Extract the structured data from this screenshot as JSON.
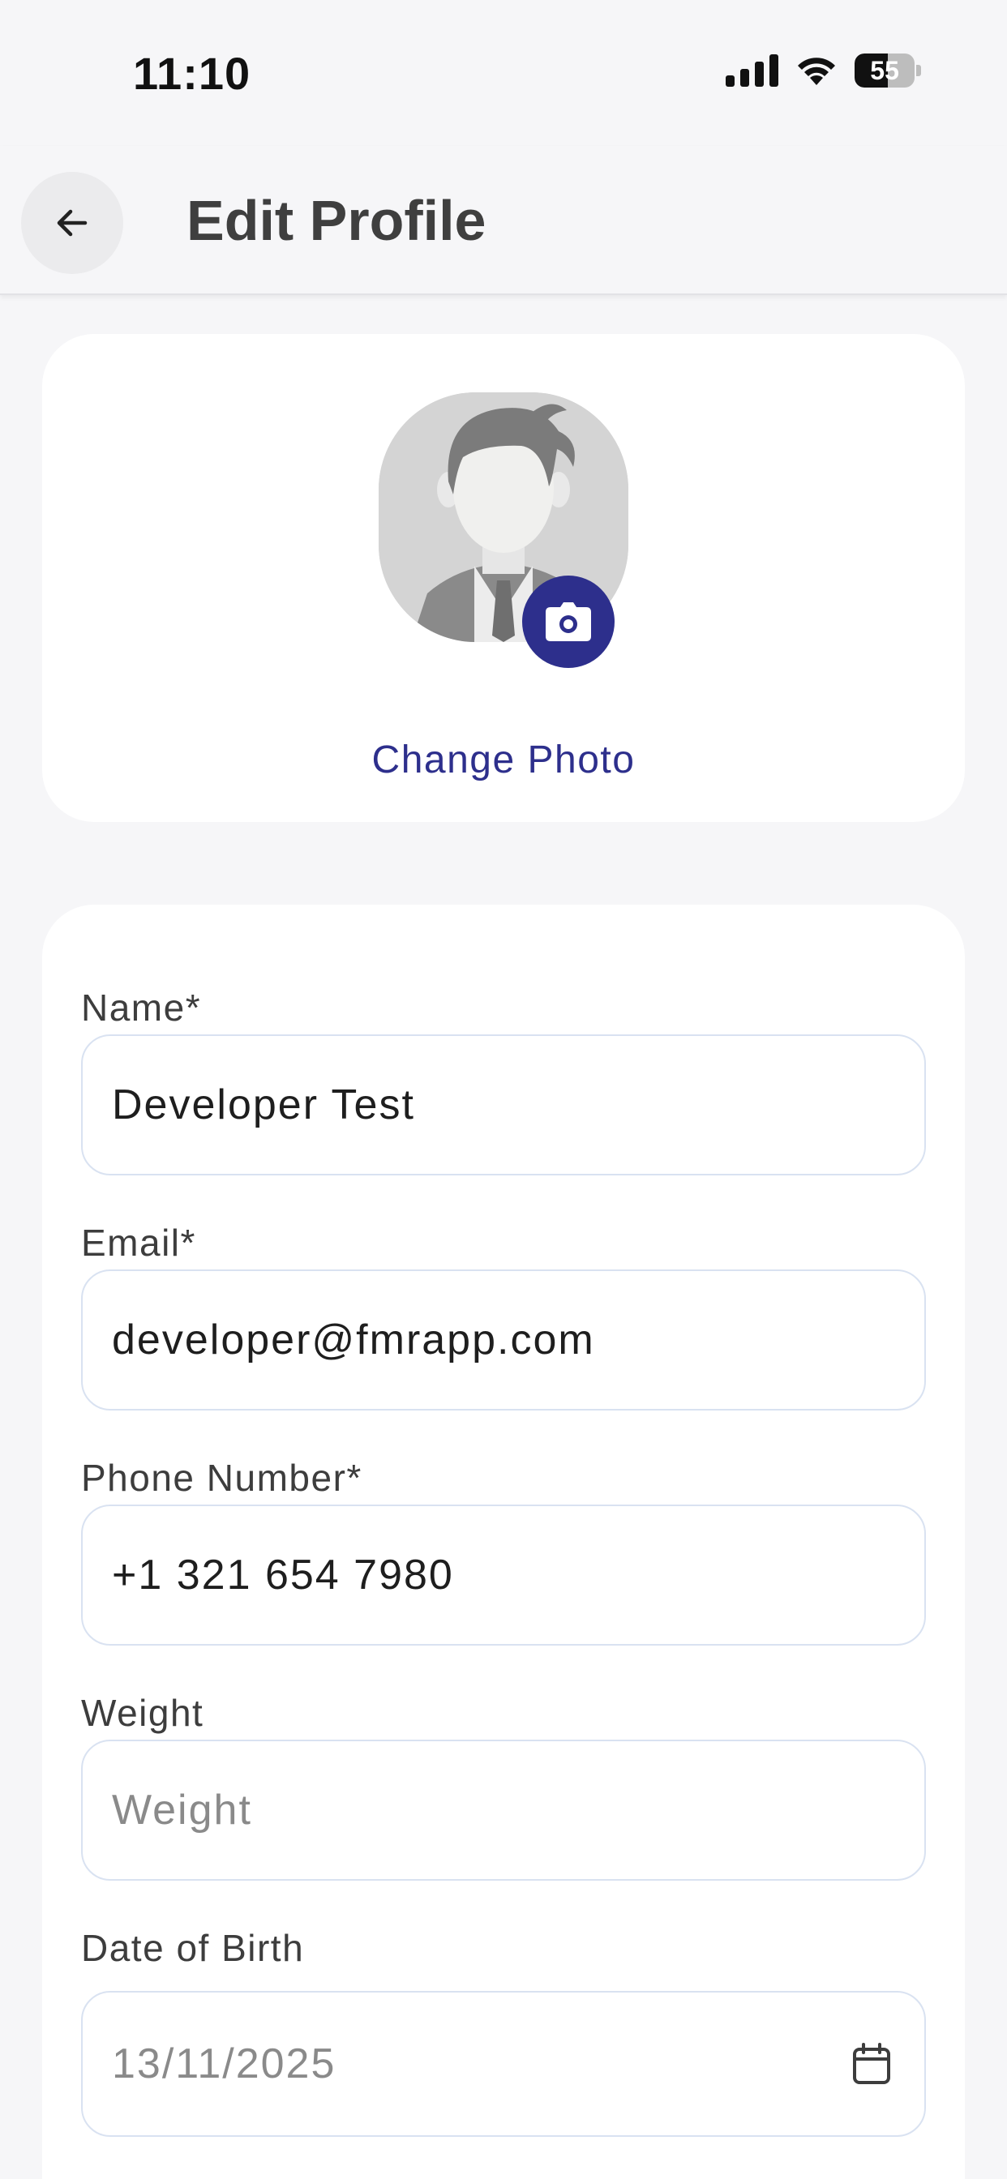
{
  "status_bar": {
    "time": "11:10",
    "battery_level": "55"
  },
  "header": {
    "title": "Edit Profile",
    "back_icon": "arrow-left-icon"
  },
  "photo": {
    "change_label": "Change Photo",
    "camera_icon": "camera-icon",
    "accent_color": "#2d2f8c"
  },
  "form": {
    "fields": [
      {
        "label": "Name*",
        "value": "Developer Test",
        "placeholder": ""
      },
      {
        "label": "Email*",
        "value": "developer@fmrapp.com",
        "placeholder": ""
      },
      {
        "label": "Phone Number*",
        "value": "+1 321 654 7980",
        "placeholder": ""
      },
      {
        "label": "Weight",
        "value": "",
        "placeholder": "Weight"
      },
      {
        "label": "Date of Birth",
        "value": "",
        "placeholder": "13/11/2025",
        "icon": "calendar-icon"
      }
    ]
  }
}
